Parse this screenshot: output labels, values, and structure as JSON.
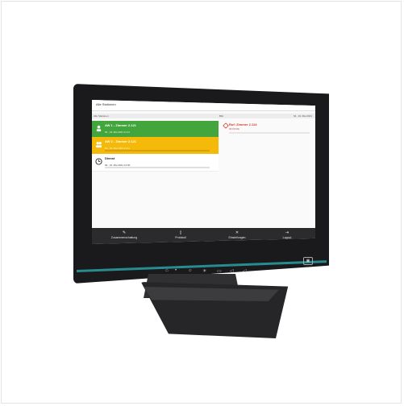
{
  "app": {
    "header_title": "Alle Stationen",
    "subheader_left": "Alle Stationen",
    "subheader_mid": "Bild",
    "subheader_right": "Mi., 19. Mai 2021"
  },
  "alerts": [
    {
      "title": "AW 1 - Zimmer 2.121",
      "time": "Mi., 19. Mai 2021  11:11",
      "color": "#43a63c"
    },
    {
      "title": "AW 2 - Zimmer 2.121",
      "time": "Mi., 19. Mai 2021  11:11",
      "color": "#f5b90a"
    },
    {
      "title": "Dienst",
      "time": "Mi., 19. Mai 2021  12:00",
      "color": "#ffffff"
    }
  ],
  "detail": {
    "title": "Ruf: Zimmer 2.114",
    "subtitle": "00:00 Min"
  },
  "bottom_nav": [
    {
      "label": "Zusammenschaltung",
      "icon": "pencil-icon"
    },
    {
      "label": "Protokoll",
      "icon": "doc-icon"
    },
    {
      "label": "Einstellungen",
      "icon": "tools-icon"
    },
    {
      "label": "Logout",
      "icon": "logout-icon"
    }
  ],
  "colors": {
    "accent_teal": "#2aa0a4",
    "alarm_red": "#d9342b"
  }
}
